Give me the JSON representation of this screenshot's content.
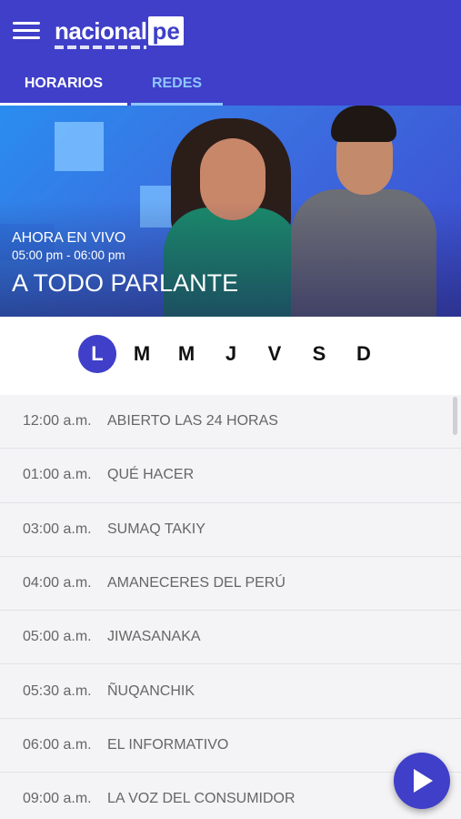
{
  "header": {
    "logo_text": "nacional",
    "logo_box": "pe",
    "tabs": [
      {
        "label": "HORARIOS",
        "active": true
      },
      {
        "label": "REDES",
        "active": false
      }
    ]
  },
  "now_playing": {
    "live_label": "AHORA EN VIVO",
    "time_range": "05:00 pm - 06:00 pm",
    "title": "A TODO PARLANTE"
  },
  "days": {
    "items": [
      "L",
      "M",
      "M",
      "J",
      "V",
      "S",
      "D"
    ],
    "selected": "L"
  },
  "schedule": [
    {
      "time": "12:00 a.m.",
      "name": "ABIERTO LAS 24 HORAS"
    },
    {
      "time": "01:00 a.m.",
      "name": "QUÉ HACER"
    },
    {
      "time": "03:00 a.m.",
      "name": "SUMAQ TAKIY"
    },
    {
      "time": "04:00 a.m.",
      "name": "AMANECERES DEL PERÚ"
    },
    {
      "time": "05:00 a.m.",
      "name": "JIWASANAKA"
    },
    {
      "time": "05:30 a.m.",
      "name": "ÑUQANCHIK"
    },
    {
      "time": "06:00 a.m.",
      "name": "EL INFORMATIVO"
    },
    {
      "time": "09:00 a.m.",
      "name": "LA VOZ DEL CONSUMIDOR"
    }
  ],
  "icons": {
    "menu": "hamburger-menu-icon",
    "play": "play-icon"
  },
  "colors": {
    "brand": "#3f3fc9",
    "tab_inactive": "#8fc6ff",
    "row_text": "#666666"
  }
}
